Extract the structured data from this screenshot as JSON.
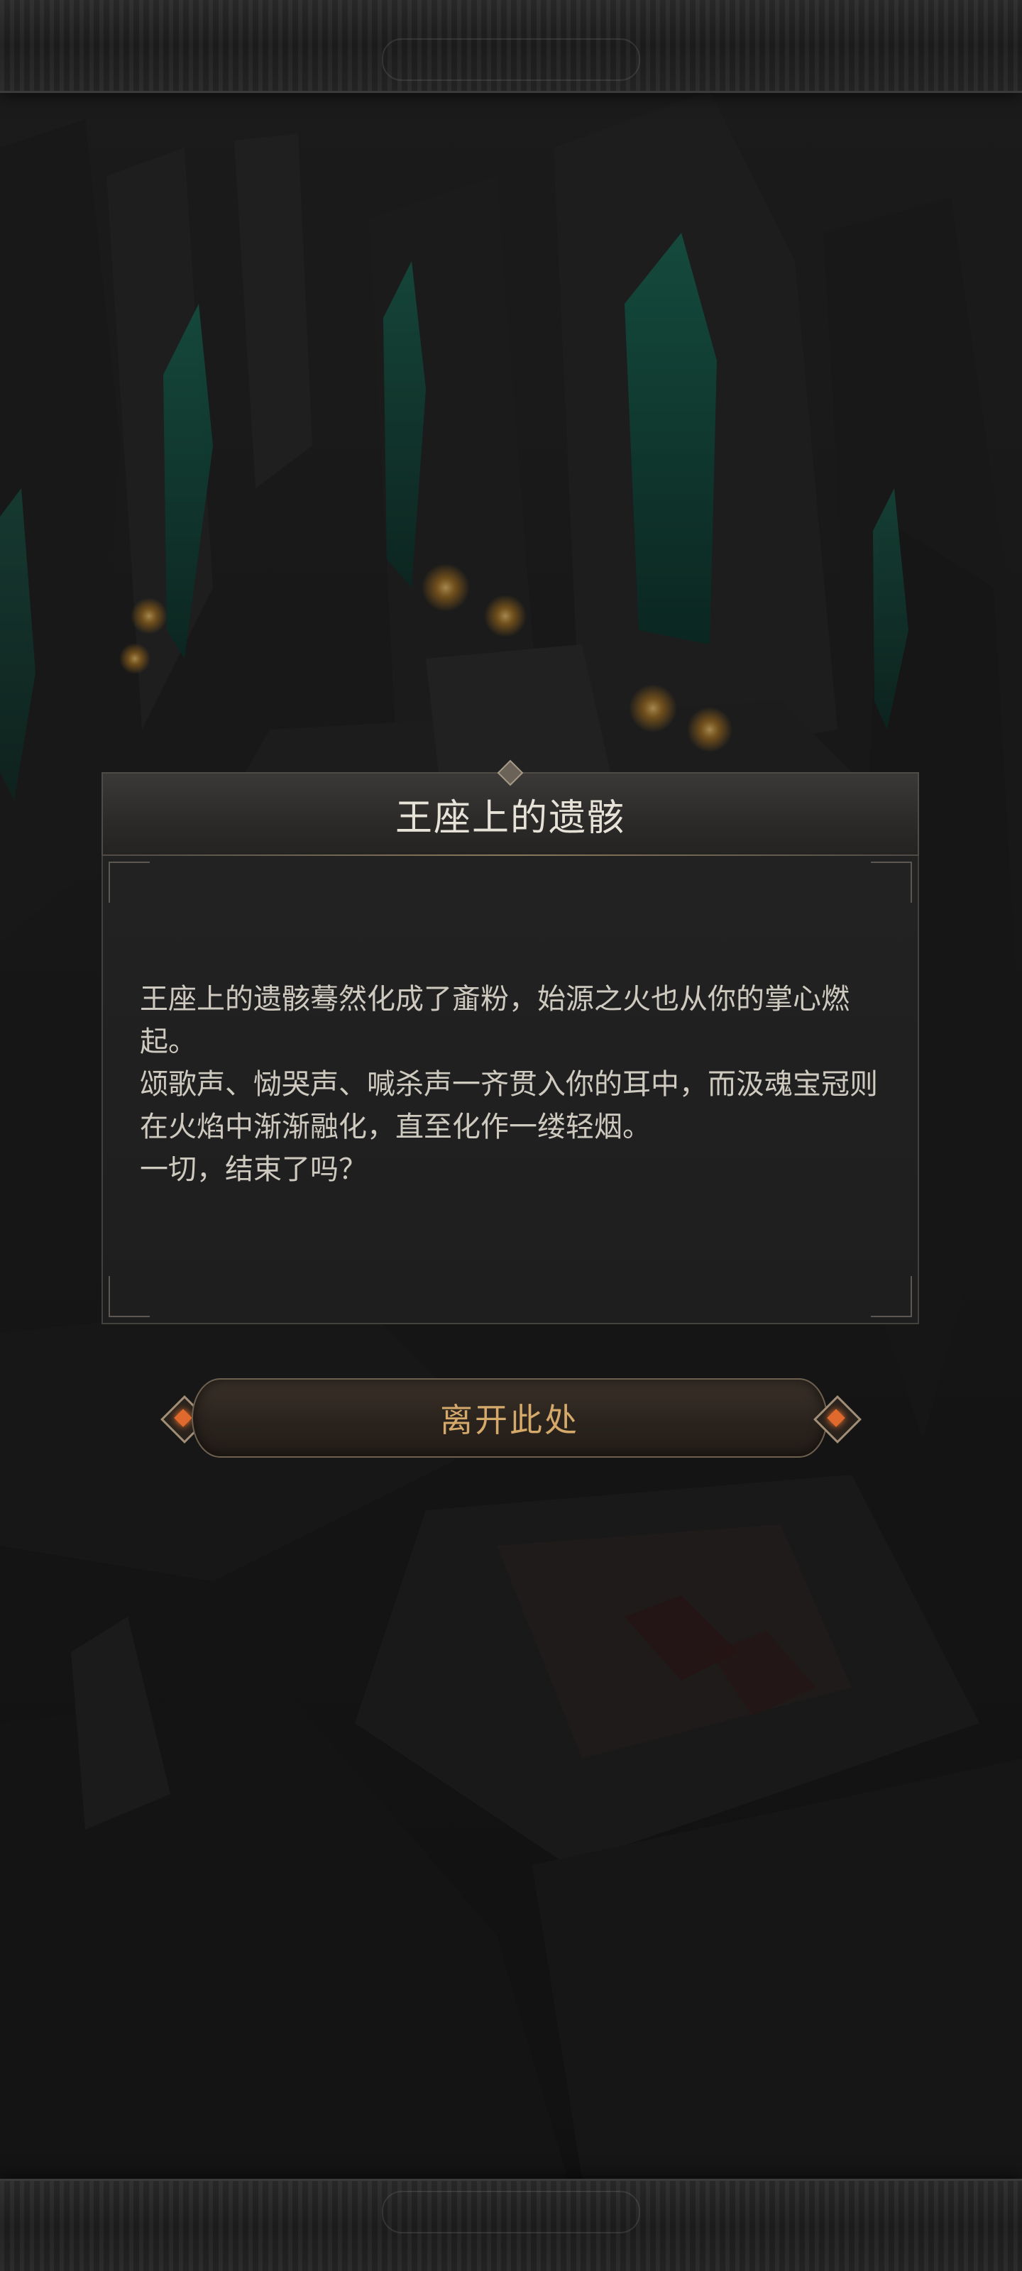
{
  "dialog": {
    "title": "王座上的遗骸",
    "paragraphs": [
      "王座上的遗骸蓦然化成了齑粉，始源之火也从你的掌心燃起。",
      "颂歌声、恸哭声、喊杀声一齐贯入你的耳中，而汲魂宝冠则在火焰中渐渐融化，直至化作一缕轻烟。",
      "一切，结束了吗？"
    ]
  },
  "actions": {
    "leave_label": "离开此处"
  },
  "colors": {
    "title_text": "#e7e2d8",
    "body_text": "#cfcac0",
    "button_text": "#d4a96a",
    "accent_gem": "#e06a2e",
    "crystal_glow": "#1f7a63"
  }
}
